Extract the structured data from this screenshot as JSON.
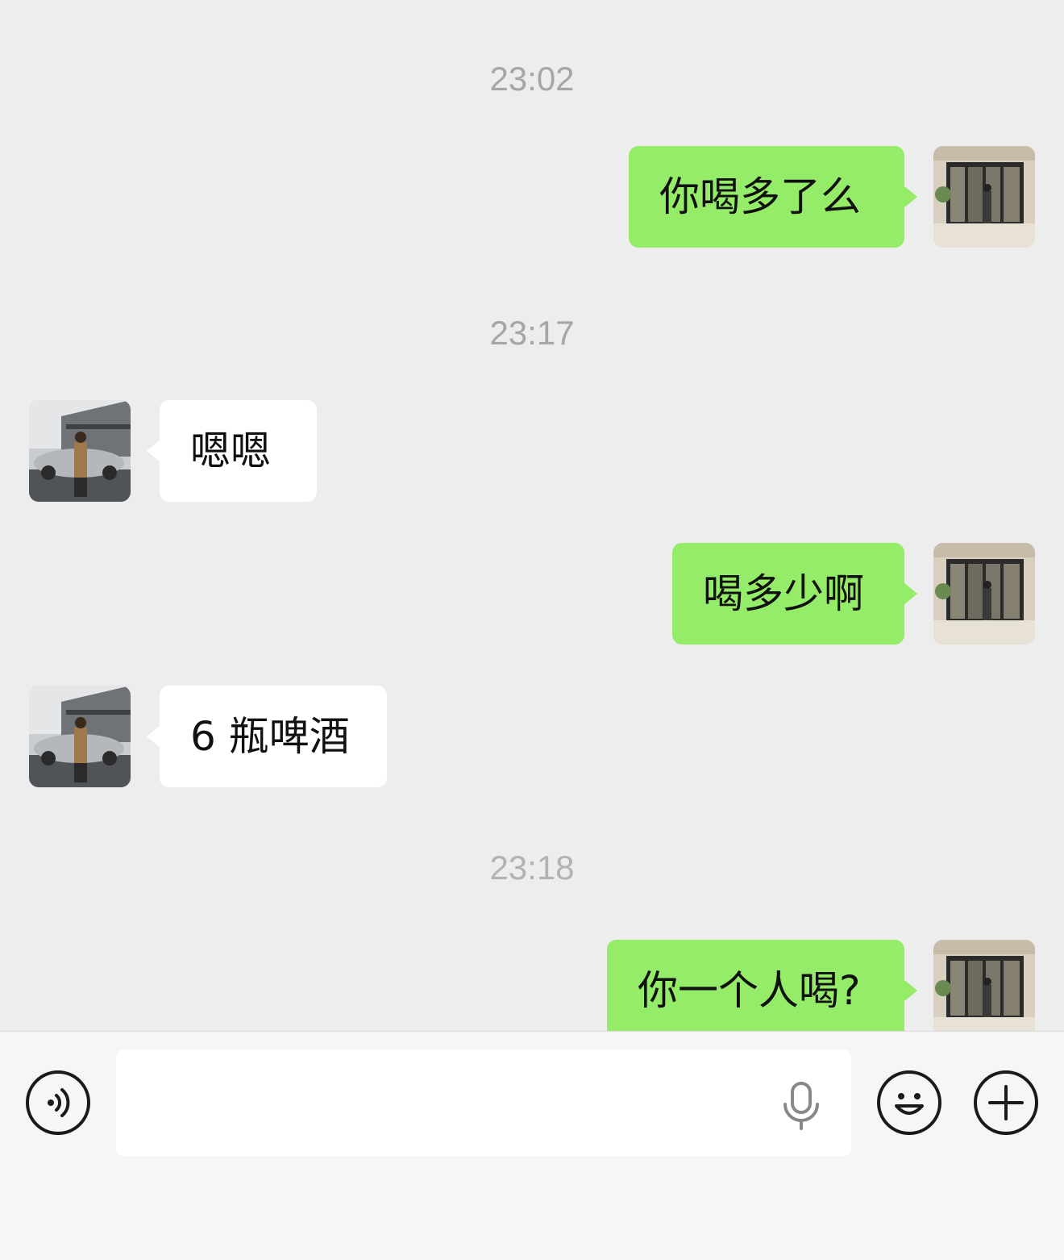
{
  "chat": {
    "timestamps": [
      "23:02",
      "23:17",
      "23:18"
    ],
    "messages": [
      {
        "side": "out",
        "text": "你喝多了么"
      },
      {
        "side": "in",
        "text": "嗯嗯"
      },
      {
        "side": "out",
        "text": "喝多少啊"
      },
      {
        "side": "in",
        "text": "6 瓶啤酒"
      },
      {
        "side": "out",
        "text": "你一个人喝?"
      }
    ]
  },
  "input_bar": {
    "text_value": "",
    "icons": [
      "voice-toggle-icon",
      "microphone-icon",
      "emoji-icon",
      "plus-icon"
    ]
  },
  "colors": {
    "outgoing_bubble": "#95ec69",
    "incoming_bubble": "#ffffff",
    "background": "#ededed",
    "timestamp": "#a6a6a6"
  }
}
